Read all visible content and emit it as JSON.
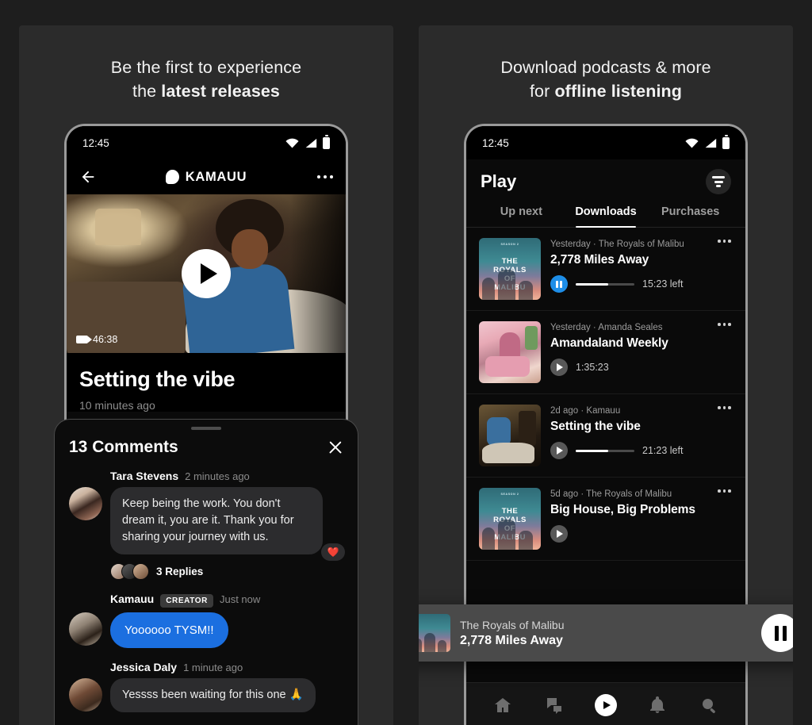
{
  "left_panel": {
    "promo_line1": "Be the first to experience",
    "promo_line2_plain": "the ",
    "promo_line2_bold": "latest releases",
    "status": {
      "time": "12:45",
      "wifi_icon": "wifi-icon",
      "signal_icon": "signal-icon",
      "battery_icon": "battery-icon"
    },
    "header": {
      "back_icon": "back-arrow-icon",
      "logo_icon": "pandora-p-logo-icon",
      "title": "KAMAUU",
      "overflow_icon": "more-options-icon"
    },
    "video": {
      "duration": "46:38",
      "duration_icon": "video-camera-icon",
      "play_icon": "play-icon",
      "title": "Setting the vibe",
      "posted": "10 minutes ago"
    },
    "comments_sheet": {
      "grabber": "drag-handle",
      "title": "13 Comments",
      "close_icon": "close-icon",
      "comments": [
        {
          "name": "Tara Stevens",
          "time": "2 minutes ago",
          "badge": "",
          "text": "Keep being the work. You don't dream it, you are it. Thank you for sharing your journey with us.",
          "reaction": "❤️",
          "bubble_style": "grey",
          "replies_label": "3 Replies"
        },
        {
          "name": "Kamauu",
          "time": "Just now",
          "badge": "CREATOR",
          "text": "Yoooooo TYSM!!",
          "reaction": "",
          "bubble_style": "blue",
          "replies_label": ""
        },
        {
          "name": "Jessica Daly",
          "time": "1 minute ago",
          "badge": "",
          "text": "Yessss been waiting for this one 🙏",
          "reaction": "",
          "bubble_style": "grey",
          "replies_label": ""
        }
      ]
    }
  },
  "right_panel": {
    "promo_line1": "Download podcasts & more",
    "promo_line2_plain": "for ",
    "promo_line2_bold": "offline listening",
    "status": {
      "time": "12:45",
      "wifi_icon": "wifi-icon",
      "signal_icon": "signal-icon",
      "battery_icon": "battery-icon"
    },
    "page_title": "Play",
    "filter_icon": "filter-icon",
    "tabs": [
      {
        "label": "Up next",
        "active": false
      },
      {
        "label": "Downloads",
        "active": true
      },
      {
        "label": "Purchases",
        "active": false
      }
    ],
    "downloads": [
      {
        "meta": "Yesterday · The Royals of Malibu",
        "title": "2,778 Miles Away",
        "control_icon": "pause-icon",
        "control_color": "#1e8ee8",
        "progress_percent": 55,
        "time_left": "15:23 left",
        "overflow_icon": "more-options-icon",
        "artwork": "the-royals-of-malibu-cover",
        "artwork_season": "SEASON 2",
        "artwork_line1": "THE",
        "artwork_line2": "ROYALS",
        "artwork_line3": "OF",
        "artwork_line4": "MALIBU"
      },
      {
        "meta": "Yesterday · Amanda Seales",
        "title": "Amandaland Weekly",
        "control_icon": "play-icon",
        "control_color": "#585858",
        "progress_percent": 0,
        "time_left": "1:35:23",
        "overflow_icon": "more-options-icon",
        "artwork": "amandaland-weekly-cover"
      },
      {
        "meta": "2d ago · Kamauu",
        "title": "Setting the vibe",
        "control_icon": "play-icon",
        "control_color": "#585858",
        "progress_percent": 55,
        "time_left": "21:23 left",
        "overflow_icon": "more-options-icon",
        "artwork": "setting-the-vibe-cover"
      },
      {
        "meta": "5d ago · The Royals of Malibu",
        "title": "Big House, Big Problems",
        "control_icon": "play-icon",
        "control_color": "#585858",
        "progress_percent": 0,
        "time_left": "",
        "overflow_icon": "more-options-icon",
        "artwork": "the-royals-of-malibu-cover",
        "artwork_season": "SEASON 2",
        "artwork_line1": "THE",
        "artwork_line2": "ROYALS",
        "artwork_line3": "OF",
        "artwork_line4": "MALIBU"
      }
    ],
    "mini_player": {
      "show": "The Royals of Malibu",
      "episode": "2,778 Miles Away",
      "button_icon": "pause-icon",
      "artwork": "the-royals-of-malibu-cover"
    },
    "bottom_nav": [
      {
        "icon": "home-icon",
        "active": false
      },
      {
        "icon": "chat-bubbles-icon",
        "active": false
      },
      {
        "icon": "play-icon",
        "active": true
      },
      {
        "icon": "bell-icon",
        "active": false
      },
      {
        "icon": "search-icon",
        "active": false
      }
    ]
  }
}
